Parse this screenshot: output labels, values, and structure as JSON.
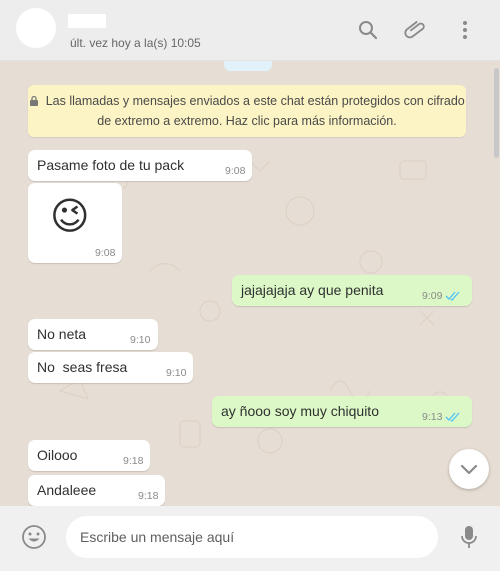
{
  "header": {
    "last_seen": "últ. vez hoy a la(s) 10:05",
    "icons": [
      "search-icon",
      "paperclip-icon",
      "kebab-menu-icon"
    ]
  },
  "encryption_notice": {
    "line1": "Las llamadas y mensajes enviados a este chat están protegidos con cifrado",
    "line2": "de extremo a extremo. Haz clic para más información."
  },
  "messages": [
    {
      "direction": "in",
      "text": "Pasame foto de tu pack",
      "time": "9:08"
    },
    {
      "direction": "in",
      "text": "😉",
      "time": "9:08"
    },
    {
      "direction": "out",
      "text": "jajajajaja ay que penita",
      "time": "9:09",
      "read": true
    },
    {
      "direction": "in",
      "text": "No neta",
      "time": "9:10"
    },
    {
      "direction": "in",
      "text": "No  seas fresa",
      "time": "9:10"
    },
    {
      "direction": "out",
      "text": "ay ñooo soy muy chiquito",
      "time": "9:13",
      "read": true
    },
    {
      "direction": "in",
      "text": "Oilooo",
      "time": "9:18"
    },
    {
      "direction": "in",
      "text": "Andaleee",
      "time": "9:18"
    }
  ],
  "composer": {
    "placeholder": "Escribe un mensaje aquí"
  },
  "colors": {
    "incoming": "#ffffff",
    "outgoing": "#dcf8c6",
    "read_ticks": "#4fc3f7",
    "chat_background": "#e6ddd4",
    "notice": "#fcf4c4"
  }
}
